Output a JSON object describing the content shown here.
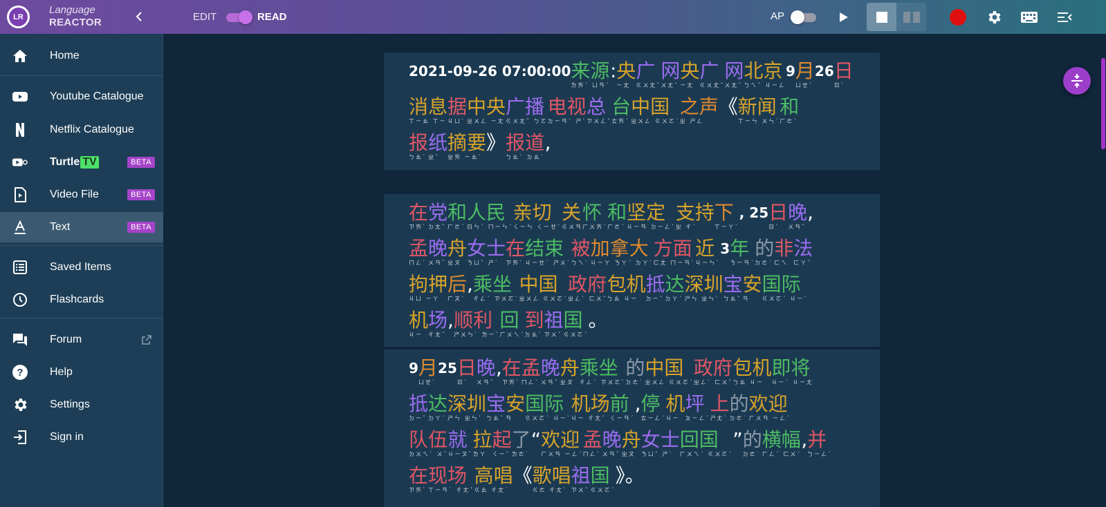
{
  "brand": {
    "logo_text": "LR",
    "top": "Language",
    "bottom": "REACTOR"
  },
  "topbar": {
    "edit_label": "EDIT",
    "read_label": "READ",
    "mode_toggle_on": true,
    "ap_label": "AP",
    "ap_toggle_on": false
  },
  "colors": {
    "accent": "#a644c9",
    "record": "#e01010",
    "tv_badge": "#4de06a"
  },
  "sidebar": {
    "items": [
      {
        "label": "Home",
        "icon": "home-icon"
      },
      {
        "label": "Youtube Catalogue",
        "icon": "youtube-icon"
      },
      {
        "label": "Netflix Catalogue",
        "icon": "netflix-icon"
      },
      {
        "label": "Turtle",
        "badge_text": "TV",
        "beta": "BETA",
        "icon": "turtle-tv-icon"
      },
      {
        "label": "Video File",
        "beta": "BETA",
        "icon": "video-file-icon"
      },
      {
        "label": "Text",
        "beta": "BETA",
        "icon": "text-icon",
        "active": true
      },
      {
        "label": "Saved Items",
        "icon": "saved-items-icon"
      },
      {
        "label": "Flashcards",
        "icon": "clock-icon"
      },
      {
        "label": "Forum",
        "icon": "forum-icon",
        "external": true
      },
      {
        "label": "Help",
        "icon": "help-icon"
      },
      {
        "label": "Settings",
        "icon": "settings-icon"
      },
      {
        "label": "Sign in",
        "icon": "sign-in-icon"
      }
    ]
  },
  "article": {
    "paragraphs": [
      {
        "lines": [
          [
            {
              "t": "2021-09-26 07:00:00 ",
              "c": "w",
              "n": true
            },
            {
              "t": "来源",
              "c": "g",
              "z": "ㄌㄞˊ ㄩㄢˊ"
            },
            {
              "t": ": ",
              "c": "w"
            },
            {
              "t": "央",
              "c": "y",
              "z": "ㄧㄤ"
            },
            {
              "t": "广",
              "c": "p",
              "z": "ㄍㄨㄤˇ"
            },
            {
              "t": "网",
              "c": "p",
              "z": "ㄨㄤˇ"
            },
            {
              "t": "央",
              "c": "y",
              "z": "ㄧㄤ"
            },
            {
              "t": "广",
              "c": "p",
              "z": "ㄍㄨㄤˇ"
            },
            {
              "t": "网",
              "c": "p",
              "z": "ㄨㄤˇ"
            },
            {
              "t": "北京",
              "c": "y",
              "z": "ㄅㄟˇ ㄐㄧㄥ"
            },
            {
              "t": "9",
              "c": "w",
              "n": true
            },
            {
              "t": "月",
              "c": "o",
              "z": "ㄩㄝˋ"
            },
            {
              "t": "26",
              "c": "w",
              "n": true
            },
            {
              "t": "日",
              "c": "r",
              "z": "ㄖˋ"
            }
          ],
          [
            {
              "t": "消息",
              "c": "y",
              "z": "ㄒㄧㄠ ㄒㄧ"
            },
            {
              "t": "据",
              "c": "r",
              "z": "ㄐㄩˋ"
            },
            {
              "t": "中央",
              "c": "y",
              "z": "ㄓㄨㄥ ㄧㄤ"
            },
            {
              "t": "广播",
              "c": "p",
              "z": "ㄍㄨㄤˇ ㄅㄛ"
            },
            {
              "t": "电视",
              "c": "r",
              "z": "ㄉㄧㄢˋ ㄕˋ"
            },
            {
              "t": "总",
              "c": "p",
              "z": "ㄗㄨㄥˇ"
            },
            {
              "t": "台",
              "c": "g",
              "z": "ㄊㄞˊ"
            },
            {
              "t": " 中国 ",
              "c": "y",
              "z": "ㄓㄨㄥ ㄍㄨㄛˊ"
            },
            {
              "t": "之声",
              "c": "o",
              "z": "ㄓ ㄕㄥ"
            },
            {
              "t": "《",
              "c": "w"
            },
            {
              "t": "新闻",
              "c": "y",
              "z": "ㄒㄧㄣ ㄨㄣˊ"
            },
            {
              "t": "和",
              "c": "g",
              "z": "ㄏㄜˊ"
            }
          ],
          [
            {
              "t": "报",
              "c": "r",
              "z": "ㄅㄠˋ"
            },
            {
              "t": "纸",
              "c": "p",
              "z": "ㄓˇ"
            },
            {
              "t": "摘要",
              "c": "y",
              "z": "ㄓㄞ ㄧㄠˋ"
            },
            {
              "t": "》",
              "c": "w"
            },
            {
              "t": "报道",
              "c": "r",
              "z": "ㄅㄠˋ ㄉㄠˋ"
            },
            {
              "t": ",",
              "c": "w"
            }
          ]
        ]
      },
      {
        "lines": [
          [
            {
              "t": "在",
              "c": "r",
              "z": "ㄗㄞˋ"
            },
            {
              "t": "党",
              "c": "p",
              "z": "ㄉㄤˇ"
            },
            {
              "t": "和",
              "c": "g",
              "z": "ㄏㄜˊ"
            },
            {
              "t": "人民 ",
              "c": "g",
              "z": "ㄖㄣˊ ㄇㄧㄣˊ"
            },
            {
              "t": "亲切 ",
              "c": "y",
              "z": "ㄑㄧㄣ ㄑㄧㄝˋ"
            },
            {
              "t": "关 ",
              "c": "y",
              "z": "ㄍㄨㄢ"
            },
            {
              "t": "怀 ",
              "c": "g",
              "z": "ㄏㄨㄞˊ"
            },
            {
              "t": "和 ",
              "c": "g",
              "z": "ㄏㄜˊ"
            },
            {
              "t": "坚定 ",
              "c": "y",
              "z": "ㄐㄧㄢ ㄉㄧㄥˋ"
            },
            {
              "t": "支持",
              "c": "y",
              "z": "ㄓ ㄔˊ"
            },
            {
              "t": "下",
              "c": "o",
              "z": "ㄒㄧㄚˋ"
            },
            {
              "t": ", 25",
              "c": "w",
              "n": true
            },
            {
              "t": "日",
              "c": "r",
              "z": "ㄖˋ"
            },
            {
              "t": "晚",
              "c": "p",
              "z": "ㄨㄢˇ"
            },
            {
              "t": ",",
              "c": "w"
            }
          ],
          [
            {
              "t": "孟",
              "c": "r",
              "z": "ㄇㄥˋ"
            },
            {
              "t": "晚",
              "c": "p",
              "z": "ㄨㄢˇ"
            },
            {
              "t": "舟",
              "c": "y",
              "z": "ㄓㄡ"
            },
            {
              "t": "女士",
              "c": "p",
              "z": "ㄋㄩˇ ㄕˋ"
            },
            {
              "t": "在",
              "c": "r",
              "z": "ㄗㄞˋ"
            },
            {
              "t": "结束",
              "c": "g",
              "z": "ㄐㄧㄝˊ ㄕㄨˋ"
            },
            {
              "t": "被",
              "c": "r",
              "z": "ㄅㄟˋ"
            },
            {
              "t": "加拿大",
              "c": "o",
              "z": "ㄐㄧㄚ ㄋㄚˊ ㄉㄚˋ"
            },
            {
              "t": "方面 ",
              "c": "r",
              "z": "ㄈㄤ ㄇㄧㄢˋ"
            },
            {
              "t": "近",
              "c": "y",
              "z": "ㄐㄧㄣˋ"
            },
            {
              "t": "3",
              "c": "w",
              "n": true
            },
            {
              "t": "年 ",
              "c": "g",
              "z": "ㄋㄧㄢˊ"
            },
            {
              "t": "的",
              "c": "gr",
              "z": "ㄉㄜ˙"
            },
            {
              "t": "非",
              "c": "r",
              "z": "ㄈㄟ"
            },
            {
              "t": "法",
              "c": "p",
              "z": "ㄈㄚˇ"
            }
          ],
          [
            {
              "t": "拘押",
              "c": "y",
              "z": "ㄐㄩ ㄧㄚ"
            },
            {
              "t": "后",
              "c": "o",
              "z": "ㄏㄡˋ"
            },
            {
              "t": ", ",
              "c": "w"
            },
            {
              "t": "乘坐 ",
              "c": "g",
              "z": "ㄔㄥˊ ㄗㄨㄛˋ"
            },
            {
              "t": "中国 ",
              "c": "y",
              "z": "ㄓㄨㄥ ㄍㄨㄛˊ"
            },
            {
              "t": "政府",
              "c": "r",
              "z": "ㄓㄥˋ ㄈㄨˇ"
            },
            {
              "t": "包机",
              "c": "y",
              "z": "ㄅㄠ ㄐㄧ"
            },
            {
              "t": "抵",
              "c": "p",
              "z": "ㄉㄧˇ"
            },
            {
              "t": "达",
              "c": "g",
              "z": "ㄉㄚˊ"
            },
            {
              "t": "深圳",
              "c": "y",
              "z": "ㄕㄣ ㄓㄣˋ"
            },
            {
              "t": "宝",
              "c": "p",
              "z": "ㄅㄠˇ"
            },
            {
              "t": "安 ",
              "c": "y",
              "z": "ㄢ"
            },
            {
              "t": "国际",
              "c": "g",
              "z": "ㄍㄨㄛˊ ㄐㄧˋ"
            }
          ],
          [
            {
              "t": "机",
              "c": "y",
              "z": "ㄐㄧ"
            },
            {
              "t": "场",
              "c": "p",
              "z": "ㄔㄤˇ"
            },
            {
              "t": ", ",
              "c": "w"
            },
            {
              "t": "顺利 ",
              "c": "r",
              "z": "ㄕㄨㄣˋ ㄌㄧˋ"
            },
            {
              "t": "回",
              "c": "g",
              "z": "ㄏㄨㄟˊ"
            },
            {
              "t": "到 ",
              "c": "r",
              "z": "ㄉㄠˋ"
            },
            {
              "t": "祖",
              "c": "p",
              "z": "ㄗㄨˇ"
            },
            {
              "t": "国",
              "c": "g",
              "z": "ㄍㄨㄛˊ"
            },
            {
              "t": "。",
              "c": "w"
            }
          ]
        ]
      },
      {
        "lines": [
          [
            {
              "t": "9",
              "c": "w",
              "n": true
            },
            {
              "t": "月",
              "c": "o",
              "z": "ㄩㄝˋ"
            },
            {
              "t": "25",
              "c": "w",
              "n": true
            },
            {
              "t": "日",
              "c": "r",
              "z": "ㄖˋ"
            },
            {
              "t": "晚",
              "c": "p",
              "z": "ㄨㄢˇ"
            },
            {
              "t": ", ",
              "c": "w"
            },
            {
              "t": "在",
              "c": "r",
              "z": "ㄗㄞˋ"
            },
            {
              "t": "孟",
              "c": "r",
              "z": "ㄇㄥˋ"
            },
            {
              "t": "晚",
              "c": "p",
              "z": "ㄨㄢˇ"
            },
            {
              "t": "舟 ",
              "c": "y",
              "z": "ㄓㄡ"
            },
            {
              "t": "乘坐",
              "c": "g",
              "z": "ㄔㄥˊ ㄗㄨㄛˋ"
            },
            {
              "t": "的 ",
              "c": "gr",
              "z": "ㄉㄜ˙"
            },
            {
              "t": "中国 ",
              "c": "y",
              "z": "ㄓㄨㄥ ㄍㄨㄛˊ"
            },
            {
              "t": "政府",
              "c": "r",
              "z": "ㄓㄥˋ ㄈㄨˇ"
            },
            {
              "t": "包机",
              "c": "y",
              "z": "ㄅㄠ ㄐㄧ"
            },
            {
              "t": "即将",
              "c": "g",
              "z": "ㄐㄧˊ ㄐㄧㄤ"
            }
          ],
          [
            {
              "t": "抵",
              "c": "p",
              "z": "ㄉㄧˇ"
            },
            {
              "t": "达",
              "c": "g",
              "z": "ㄉㄚˊ"
            },
            {
              "t": "深圳",
              "c": "y",
              "z": "ㄕㄣ ㄓㄣˋ"
            },
            {
              "t": "宝",
              "c": "p",
              "z": "ㄅㄠˇ"
            },
            {
              "t": "安 ",
              "c": "y",
              "z": "ㄢ"
            },
            {
              "t": "国际 ",
              "c": "g",
              "z": "ㄍㄨㄛˊ ㄐㄧˋ"
            },
            {
              "t": "机场 ",
              "c": "y",
              "z": "ㄐㄧ ㄔㄤˇ"
            },
            {
              "t": "前",
              "c": "g",
              "z": "ㄑㄧㄢˊ"
            },
            {
              "t": ", ",
              "c": "w"
            },
            {
              "t": "停",
              "c": "g",
              "z": "ㄊㄧㄥˊ"
            },
            {
              "t": "机",
              "c": "y",
              "z": "ㄐㄧ"
            },
            {
              "t": "坪 ",
              "c": "p",
              "z": "ㄆㄧㄥˊ"
            },
            {
              "t": "上",
              "c": "r",
              "z": "ㄕㄤˋ"
            },
            {
              "t": "的 ",
              "c": "gr",
              "z": "ㄉㄜ˙"
            },
            {
              "t": "欢迎",
              "c": "y",
              "z": "ㄏㄨㄢ ㄧㄥˊ"
            }
          ],
          [
            {
              "t": "队伍 ",
              "c": "r",
              "z": "ㄉㄨㄟˋ ㄨˇ"
            },
            {
              "t": "就 ",
              "c": "p",
              "z": "ㄐㄧㄡˋ"
            },
            {
              "t": "拉",
              "c": "y",
              "z": "ㄌㄚ"
            },
            {
              "t": "起",
              "c": "r",
              "z": "ㄑㄧˇ"
            },
            {
              "t": "了",
              "c": "gr",
              "z": "ㄌㄜ˙"
            },
            {
              "t": "“",
              "c": "w"
            },
            {
              "t": "欢迎",
              "c": "y",
              "z": "ㄏㄨㄢ ㄧㄥˊ"
            },
            {
              "t": "孟",
              "c": "r",
              "z": "ㄇㄥˋ"
            },
            {
              "t": "晚",
              "c": "p",
              "z": "ㄨㄢˇ"
            },
            {
              "t": "舟",
              "c": "y",
              "z": "ㄓㄡ"
            },
            {
              "t": "女士 ",
              "c": "p",
              "z": "ㄋㄩˇ ㄕˋ"
            },
            {
              "t": "回国 ",
              "c": "g",
              "z": "ㄏㄨㄟˊ ㄍㄨㄛˊ"
            },
            {
              "t": "”",
              "c": "w"
            },
            {
              "t": "的",
              "c": "gr",
              "z": "ㄉㄜ˙"
            },
            {
              "t": "横幅",
              "c": "g",
              "z": "ㄏㄥˊ ㄈㄨˊ"
            },
            {
              "t": ", ",
              "c": "w"
            },
            {
              "t": "并",
              "c": "r",
              "z": "ㄅㄧㄥˋ"
            }
          ],
          [
            {
              "t": "在 ",
              "c": "r",
              "z": "ㄗㄞˋ"
            },
            {
              "t": "现场 ",
              "c": "r",
              "z": "ㄒㄧㄢˋ ㄔㄤˇ"
            },
            {
              "t": "高唱",
              "c": "y",
              "z": "ㄍㄠ ㄔㄤˋ"
            },
            {
              "t": "《",
              "c": "w"
            },
            {
              "t": "歌唱 ",
              "c": "y",
              "z": "ㄍㄜ ㄔㄤˋ"
            },
            {
              "t": "祖",
              "c": "p",
              "z": "ㄗㄨˇ"
            },
            {
              "t": "国",
              "c": "g",
              "z": "ㄍㄨㄛˊ"
            },
            {
              "t": "》。",
              "c": "w"
            }
          ]
        ]
      }
    ]
  }
}
